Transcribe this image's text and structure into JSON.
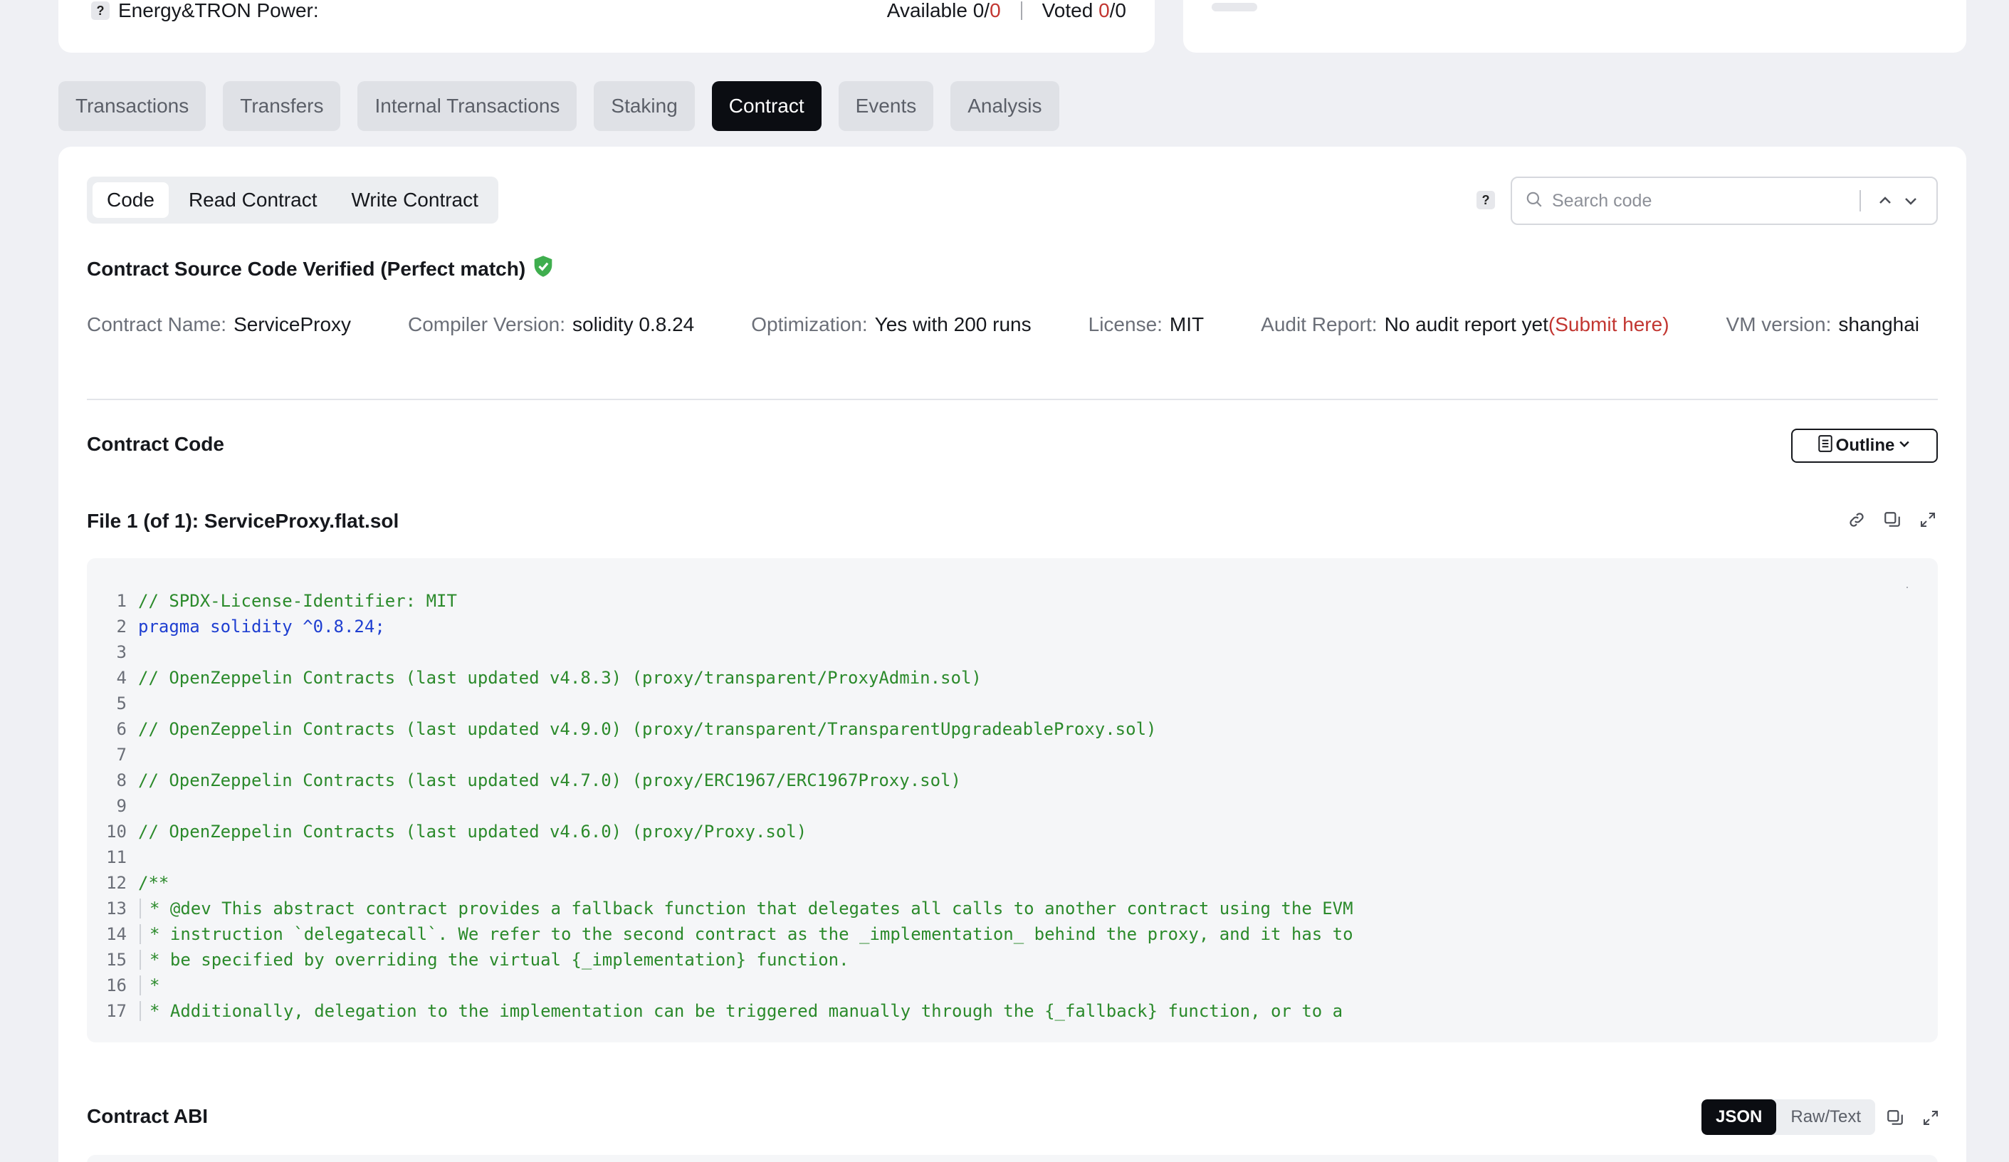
{
  "top": {
    "energy_label": "Energy&TRON Power:",
    "available_label": "Available 0/",
    "available_value": "0",
    "voted_label": "Voted ",
    "voted_value": "0",
    "voted_total": "/0"
  },
  "tabs": [
    "Transactions",
    "Transfers",
    "Internal Transactions",
    "Staking",
    "Contract",
    "Events",
    "Analysis"
  ],
  "active_tab": "Contract",
  "subtabs": [
    "Code",
    "Read Contract",
    "Write Contract"
  ],
  "search": {
    "placeholder": "Search code"
  },
  "verified": {
    "title": "Contract Source Code Verified (Perfect match)"
  },
  "info": {
    "contract_name_label": "Contract Name:",
    "contract_name": "ServiceProxy",
    "compiler_label": "Compiler Version:",
    "compiler": "solidity 0.8.24",
    "optimization_label": "Optimization:",
    "optimization": "Yes with 200 runs",
    "license_label": "License:",
    "license": "MIT",
    "audit_label": "Audit Report:",
    "audit": "No audit report yet",
    "audit_link": "(Submit here)",
    "vm_label": "VM version:",
    "vm": "shanghai"
  },
  "contract_code": {
    "title": "Contract Code",
    "outline_label": "Outline"
  },
  "file": {
    "title": "File 1 (of 1): ServiceProxy.flat.sol"
  },
  "code": {
    "lines": [
      "// SPDX-License-Identifier: MIT",
      "pragma solidity ^0.8.24;",
      "",
      "// OpenZeppelin Contracts (last updated v4.8.3) (proxy/transparent/ProxyAdmin.sol)",
      "",
      "// OpenZeppelin Contracts (last updated v4.9.0) (proxy/transparent/TransparentUpgradeableProxy.sol)",
      "",
      "// OpenZeppelin Contracts (last updated v4.7.0) (proxy/ERC1967/ERC1967Proxy.sol)",
      "",
      "// OpenZeppelin Contracts (last updated v4.6.0) (proxy/Proxy.sol)",
      "",
      "/**",
      "* @dev This abstract contract provides a fallback function that delegates all calls to another contract using the EVM",
      "* instruction `delegatecall`. We refer to the second contract as the _implementation_ behind the proxy, and it has to",
      "* be specified by overriding the virtual {_implementation} function.",
      "*",
      "* Additionally, delegation to the implementation can be triggered manually through the {_fallback} function, or to a"
    ]
  },
  "abi": {
    "title": "Contract ABI",
    "json_label": "JSON",
    "raw_label": "Raw/Text"
  }
}
